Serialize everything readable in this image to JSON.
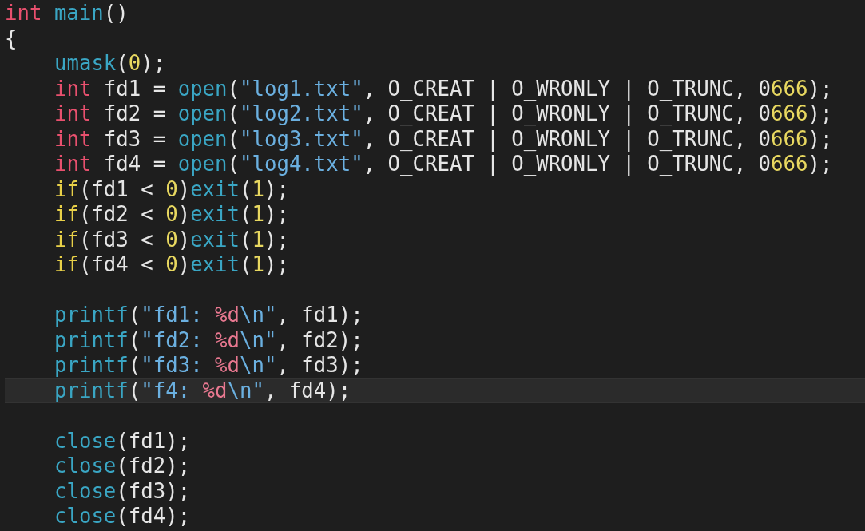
{
  "lines": [
    {
      "current": false,
      "tokens": [
        {
          "kind": "type",
          "text": "int "
        },
        {
          "kind": "func",
          "text": "main"
        },
        {
          "kind": "plain",
          "text": "()"
        }
      ]
    },
    {
      "current": false,
      "tokens": [
        {
          "kind": "plain",
          "text": "{"
        }
      ],
      "children": [
        {
          "current": false,
          "tokens": [
            {
              "kind": "func",
              "text": "umask"
            },
            {
              "kind": "plain",
              "text": "("
            },
            {
              "kind": "number",
              "text": "0"
            },
            {
              "kind": "plain",
              "text": ");"
            }
          ]
        },
        {
          "current": false,
          "tokens": [
            {
              "kind": "type",
              "text": "int"
            },
            {
              "kind": "plain",
              "text": " fd1 = "
            },
            {
              "kind": "func",
              "text": "open"
            },
            {
              "kind": "plain",
              "text": "("
            },
            {
              "kind": "string",
              "text": "\"log1.txt\""
            },
            {
              "kind": "plain",
              "text": ", O_CREAT | O_WRONLY | O_TRUNC, 0"
            },
            {
              "kind": "number",
              "text": "666"
            },
            {
              "kind": "plain",
              "text": ");"
            }
          ]
        },
        {
          "current": false,
          "tokens": [
            {
              "kind": "type",
              "text": "int"
            },
            {
              "kind": "plain",
              "text": " fd2 = "
            },
            {
              "kind": "func",
              "text": "open"
            },
            {
              "kind": "plain",
              "text": "("
            },
            {
              "kind": "string",
              "text": "\"log2.txt\""
            },
            {
              "kind": "plain",
              "text": ", O_CREAT | O_WRONLY | O_TRUNC, 0"
            },
            {
              "kind": "number",
              "text": "666"
            },
            {
              "kind": "plain",
              "text": ");"
            }
          ]
        },
        {
          "current": false,
          "tokens": [
            {
              "kind": "type",
              "text": "int"
            },
            {
              "kind": "plain",
              "text": " fd3 = "
            },
            {
              "kind": "func",
              "text": "open"
            },
            {
              "kind": "plain",
              "text": "("
            },
            {
              "kind": "string",
              "text": "\"log3.txt\""
            },
            {
              "kind": "plain",
              "text": ", O_CREAT | O_WRONLY | O_TRUNC, 0"
            },
            {
              "kind": "number",
              "text": "666"
            },
            {
              "kind": "plain",
              "text": ");"
            }
          ]
        },
        {
          "current": false,
          "tokens": [
            {
              "kind": "type",
              "text": "int"
            },
            {
              "kind": "plain",
              "text": " fd4 = "
            },
            {
              "kind": "func",
              "text": "open"
            },
            {
              "kind": "plain",
              "text": "("
            },
            {
              "kind": "string",
              "text": "\"log4.txt\""
            },
            {
              "kind": "plain",
              "text": ", O_CREAT | O_WRONLY | O_TRUNC, 0"
            },
            {
              "kind": "number",
              "text": "666"
            },
            {
              "kind": "plain",
              "text": ");"
            }
          ]
        },
        {
          "current": false,
          "tokens": [
            {
              "kind": "keyword",
              "text": "if"
            },
            {
              "kind": "plain",
              "text": "(fd1 < "
            },
            {
              "kind": "number",
              "text": "0"
            },
            {
              "kind": "plain",
              "text": ")"
            },
            {
              "kind": "func",
              "text": "exit"
            },
            {
              "kind": "plain",
              "text": "("
            },
            {
              "kind": "number",
              "text": "1"
            },
            {
              "kind": "plain",
              "text": ");"
            }
          ]
        },
        {
          "current": false,
          "tokens": [
            {
              "kind": "keyword",
              "text": "if"
            },
            {
              "kind": "plain",
              "text": "(fd2 < "
            },
            {
              "kind": "number",
              "text": "0"
            },
            {
              "kind": "plain",
              "text": ")"
            },
            {
              "kind": "func",
              "text": "exit"
            },
            {
              "kind": "plain",
              "text": "("
            },
            {
              "kind": "number",
              "text": "1"
            },
            {
              "kind": "plain",
              "text": ");"
            }
          ]
        },
        {
          "current": false,
          "tokens": [
            {
              "kind": "keyword",
              "text": "if"
            },
            {
              "kind": "plain",
              "text": "(fd3 < "
            },
            {
              "kind": "number",
              "text": "0"
            },
            {
              "kind": "plain",
              "text": ")"
            },
            {
              "kind": "func",
              "text": "exit"
            },
            {
              "kind": "plain",
              "text": "("
            },
            {
              "kind": "number",
              "text": "1"
            },
            {
              "kind": "plain",
              "text": ");"
            }
          ]
        },
        {
          "current": false,
          "tokens": [
            {
              "kind": "keyword",
              "text": "if"
            },
            {
              "kind": "plain",
              "text": "(fd4 < "
            },
            {
              "kind": "number",
              "text": "0"
            },
            {
              "kind": "plain",
              "text": ")"
            },
            {
              "kind": "func",
              "text": "exit"
            },
            {
              "kind": "plain",
              "text": "("
            },
            {
              "kind": "number",
              "text": "1"
            },
            {
              "kind": "plain",
              "text": ");"
            }
          ]
        },
        {
          "current": false
        },
        {
          "current": false,
          "tokens": [
            {
              "kind": "func",
              "text": "printf"
            },
            {
              "kind": "plain",
              "text": "("
            },
            {
              "kind": "string",
              "text": "\"fd1: "
            },
            {
              "kind": "format",
              "text": "%d"
            },
            {
              "kind": "string",
              "text": "\\n\""
            },
            {
              "kind": "plain",
              "text": ", fd1);"
            }
          ]
        },
        {
          "current": false,
          "tokens": [
            {
              "kind": "func",
              "text": "printf"
            },
            {
              "kind": "plain",
              "text": "("
            },
            {
              "kind": "string",
              "text": "\"fd2: "
            },
            {
              "kind": "format",
              "text": "%d"
            },
            {
              "kind": "string",
              "text": "\\n\""
            },
            {
              "kind": "plain",
              "text": ", fd2);"
            }
          ]
        },
        {
          "current": false,
          "tokens": [
            {
              "kind": "func",
              "text": "printf"
            },
            {
              "kind": "plain",
              "text": "("
            },
            {
              "kind": "string",
              "text": "\"fd3: "
            },
            {
              "kind": "format",
              "text": "%d"
            },
            {
              "kind": "string",
              "text": "\\n\""
            },
            {
              "kind": "plain",
              "text": ", fd3);"
            }
          ]
        },
        {
          "current": true,
          "tokens": [
            {
              "kind": "func",
              "text": "printf"
            },
            {
              "kind": "plain",
              "text": "("
            },
            {
              "kind": "string",
              "text": "\"f4: "
            },
            {
              "kind": "format",
              "text": "%d"
            },
            {
              "kind": "string",
              "text": "\\n\""
            },
            {
              "kind": "plain",
              "text": ", fd4);"
            }
          ]
        },
        {
          "current": false
        },
        {
          "current": false,
          "tokens": [
            {
              "kind": "func",
              "text": "close"
            },
            {
              "kind": "plain",
              "text": "(fd1);"
            }
          ]
        },
        {
          "current": false,
          "tokens": [
            {
              "kind": "func",
              "text": "close"
            },
            {
              "kind": "plain",
              "text": "(fd2);"
            }
          ]
        },
        {
          "current": false,
          "tokens": [
            {
              "kind": "func",
              "text": "close"
            },
            {
              "kind": "plain",
              "text": "(fd3);"
            }
          ]
        },
        {
          "current": false,
          "tokens": [
            {
              "kind": "func",
              "text": "close"
            },
            {
              "kind": "plain",
              "text": "(fd4);"
            }
          ]
        }
      ]
    }
  ]
}
